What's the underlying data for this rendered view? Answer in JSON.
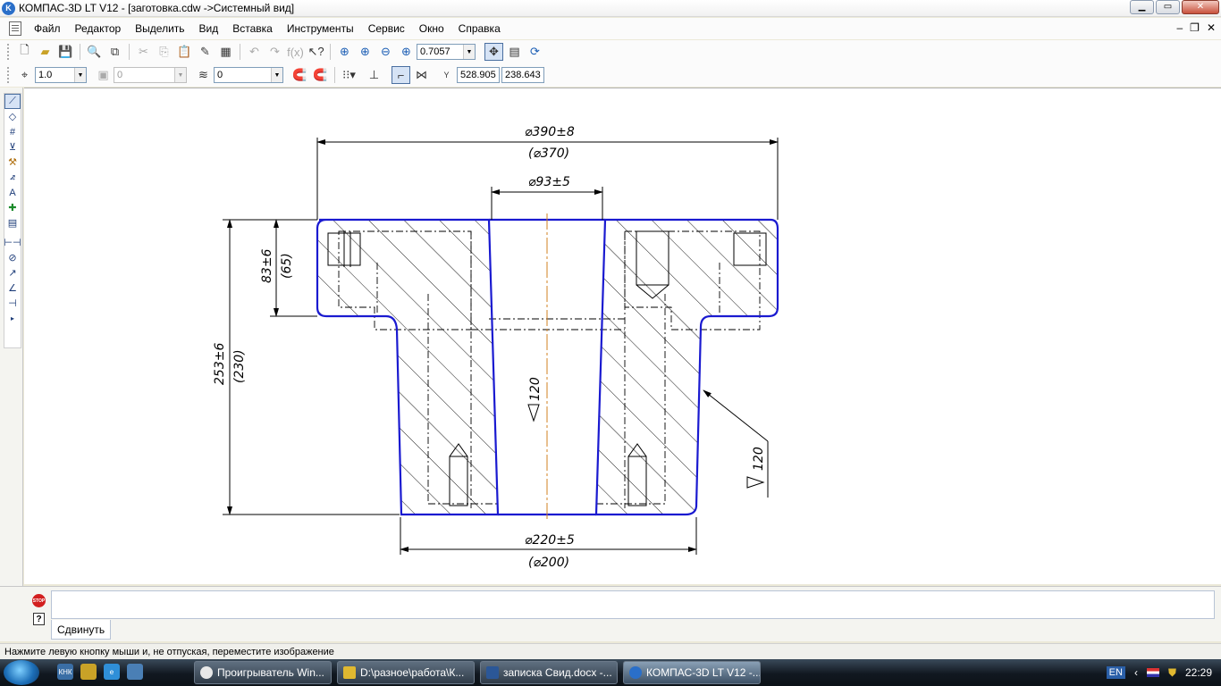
{
  "window": {
    "title": "КОМПАС-3D LT V12 - [заготовка.cdw ->Системный вид]",
    "controls": [
      "minimize",
      "maximize",
      "close"
    ]
  },
  "menu": {
    "items": [
      "Файл",
      "Редактор",
      "Выделить",
      "Вид",
      "Вставка",
      "Инструменты",
      "Сервис",
      "Окно",
      "Справка"
    ]
  },
  "toolbar1": {
    "icons": [
      "new-icon",
      "open-icon",
      "save-icon",
      "preview-icon",
      "properties-icon",
      "cut-icon",
      "copy-icon",
      "paste-icon",
      "format-icon",
      "table-icon",
      "undo-icon",
      "redo-icon",
      "function-icon",
      "help-pointer-icon",
      "zoom-window-icon",
      "zoom-in-icon",
      "zoom-out-icon",
      "zoom-scale-icon",
      "pan-icon",
      "view-icon",
      "refresh-icon"
    ],
    "zoom_value": "0.7057"
  },
  "toolbar2": {
    "step_value": "1.0",
    "layer_value": "0",
    "style_value": "0",
    "coord_label": "Y",
    "coord_x": "528.905",
    "coord_y": "238.643"
  },
  "drawing": {
    "dim_top_outer": "⌀390±8",
    "dim_top_outer_ref": "(⌀370)",
    "dim_bore": "⌀93±5",
    "dim_flange_height": "83±6",
    "dim_flange_height_ref": "(65)",
    "dim_total_height": "253±6",
    "dim_total_height_ref": "(230)",
    "dim_bottom": "⌀220±5",
    "dim_bottom_ref": "(⌀200)",
    "roughness_inner": "120",
    "roughness_outer": "120",
    "outline_color": "#1a1ad0",
    "axis_color": "#d08020"
  },
  "command_panel": {
    "tab_label": "Сдвинуть",
    "stop_label": "STOP"
  },
  "status": {
    "text": "Нажмите левую кнопку мыши и, не отпуская, переместите изображение"
  },
  "taskbar": {
    "tasks": [
      "Проигрыватель Win...",
      "D:\\разное\\работа\\К...",
      "записка Свид.docx -...",
      "КОМПАС-3D LT V12 -..."
    ],
    "lang": "EN",
    "time": "22:29"
  }
}
